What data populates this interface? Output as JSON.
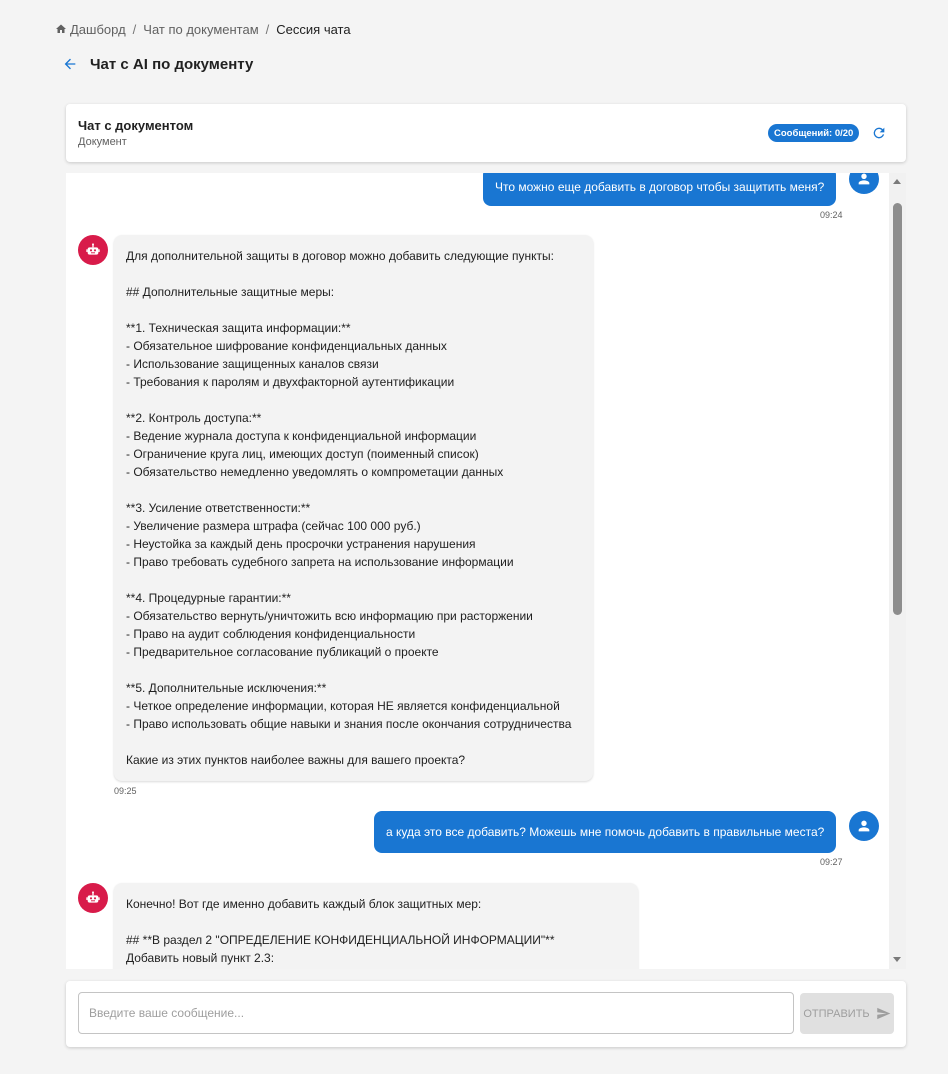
{
  "breadcrumb": {
    "items": [
      "Дашборд",
      "Чат по документам"
    ],
    "current": "Сессия чата",
    "separator": "/"
  },
  "page": {
    "title": "Чат с AI по документу"
  },
  "document_card": {
    "title": "Чат с документом",
    "subtitle": "Документ",
    "message_count": "Сообщений: 0/20"
  },
  "messages": [
    {
      "role": "user",
      "text": "Что можно еще добавить в договор чтобы защитить меня?",
      "time": "09:24"
    },
    {
      "role": "assistant",
      "text": "Для дополнительной защиты в договор можно добавить следующие пункты:\n\n## Дополнительные защитные меры:\n\n**1. Техническая защита информации:**\n- Обязательное шифрование конфиденциальных данных\n- Использование защищенных каналов связи\n- Требования к паролям и двухфакторной аутентификации\n\n**2. Контроль доступа:**\n- Ведение журнала доступа к конфиденциальной информации\n- Ограничение круга лиц, имеющих доступ (поименный список)\n- Обязательство немедленно уведомлять о компрометации данных\n\n**3. Усиление ответственности:**\n- Увеличение размера штрафа (сейчас 100 000 руб.)\n- Неустойка за каждый день просрочки устранения нарушения\n- Право требовать судебного запрета на использование информации\n\n**4. Процедурные гарантии:**\n- Обязательство вернуть/уничтожить всю информацию при расторжении\n- Право на аудит соблюдения конфиденциальности\n- Предварительное согласование публикаций о проекте\n\n**5. Дополнительные исключения:**\n- Четкое определение информации, которая НЕ является конфиденциальной\n- Право использовать общие навыки и знания после окончания сотрудничества\n\nКакие из этих пунктов наиболее важны для вашего проекта?",
      "time": "09:25"
    },
    {
      "role": "user",
      "text": "а куда это все добавить? Можешь мне помочь добавить в правильные места?",
      "time": "09:27"
    },
    {
      "role": "assistant",
      "text": "Конечно! Вот где именно добавить каждый блок защитных мер:\n\n## **В раздел 2 \"ОПРЕДЕЛЕНИЕ КОНФИДЕНЦИАЛЬНОЙ ИНФОРМАЦИИ\"**\nДобавить новый пункт 2.3:",
      "time": ""
    }
  ],
  "composer": {
    "placeholder": "Введите ваше сообщение...",
    "value": "",
    "send_label": "ОТПРАВИТЬ"
  },
  "icons": {
    "home": "home-icon",
    "back": "arrow-left-icon",
    "refresh": "refresh-icon",
    "user_avatar": "person-icon",
    "bot_avatar": "robot-icon",
    "send": "send-icon"
  },
  "colors": {
    "accent": "#1976d2",
    "bot_avatar": "#d81b4a",
    "bot_bubble": "#f3f3f3",
    "page_bg": "#f4f4f4"
  }
}
